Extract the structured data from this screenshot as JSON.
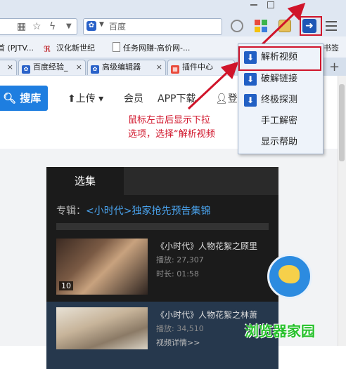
{
  "toolbar": {
    "search_text": "百度"
  },
  "bookmarks": [
    {
      "label": "首 (PJTV..."
    },
    {
      "label": "汉化新世纪"
    },
    {
      "label": "任务网赚-高价网-..."
    },
    {
      "label": "书签"
    }
  ],
  "tabs": [
    {
      "label": "百度经验_"
    },
    {
      "label": "高级编辑器"
    },
    {
      "label": "插件中心"
    }
  ],
  "page_nav": {
    "search_button": "搜库",
    "upload": "上传",
    "member": "会员",
    "app_download": "APP下载",
    "login": "登"
  },
  "dropdown_menu": {
    "items": [
      {
        "label": "解析视频"
      },
      {
        "label": "破解链接"
      },
      {
        "label": "终极探测"
      },
      {
        "label": "手工解密"
      },
      {
        "label": "显示帮助"
      }
    ]
  },
  "annotation": {
    "line1": "鼠标左击后显示下拉",
    "line2": "选项，选择“解析视频"
  },
  "video_panel": {
    "tab": "选集",
    "album_prefix": "专辑：",
    "album_title": "<小时代>独家抢先预告集锦",
    "videos": [
      {
        "title": "《小时代》人物花絮之顾里",
        "plays": "播放: 27,307",
        "duration": "时长: 01:58",
        "badge": "10"
      },
      {
        "title": "《小时代》人物花絮之林萧",
        "plays": "播放: 34,510",
        "details": "视频详情>>"
      }
    ]
  },
  "watermark": "浏览器家园",
  "colors": {
    "accent_blue": "#1e56b5",
    "annotation_red": "#d0142a",
    "watermark_green": "#27c12b"
  }
}
